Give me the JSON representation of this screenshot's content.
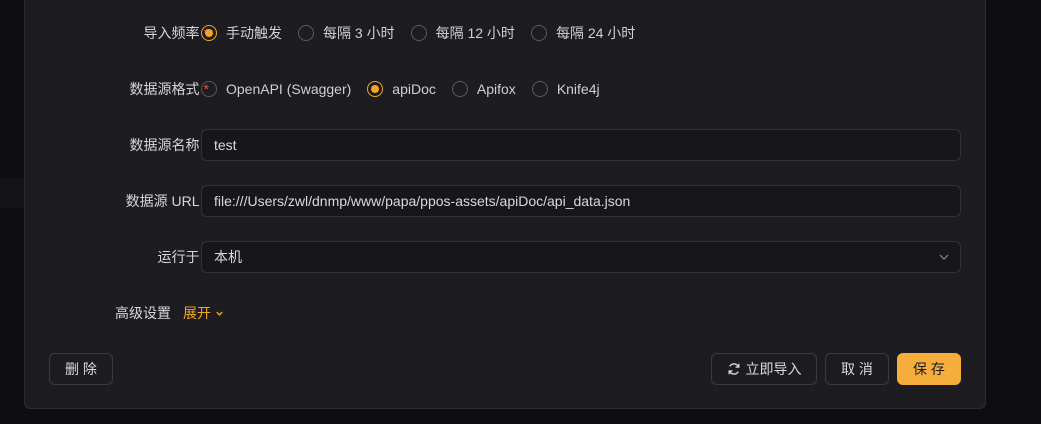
{
  "form": {
    "import_frequency": {
      "label": "导入频率",
      "required_mark": "*",
      "options": [
        {
          "label": "手动触发",
          "checked": true
        },
        {
          "label": "每隔 3 小时",
          "checked": false
        },
        {
          "label": "每隔 12 小时",
          "checked": false
        },
        {
          "label": "每隔 24 小时",
          "checked": false
        }
      ]
    },
    "source_format": {
      "label": "数据源格式",
      "required_mark": "*",
      "options": [
        {
          "label": "OpenAPI (Swagger)",
          "checked": false
        },
        {
          "label": "apiDoc",
          "checked": true
        },
        {
          "label": "Apifox",
          "checked": false
        },
        {
          "label": "Knife4j",
          "checked": false
        }
      ]
    },
    "source_name": {
      "label": "数据源名称",
      "required_mark": "*",
      "value": "test"
    },
    "source_url": {
      "label": "数据源 URL",
      "required_mark": "*",
      "value": "file:///Users/zwl/dnmp/www/papa/ppos-assets/apiDoc/api_data.json"
    },
    "run_on": {
      "label": "运行于",
      "required_mark": "*",
      "value": "本机"
    },
    "advanced": {
      "label": "高级设置",
      "toggle_label": "展开"
    }
  },
  "footer": {
    "delete_label": "删 除",
    "import_now_label": "立即导入",
    "cancel_label": "取 消",
    "save_label": "保 存"
  },
  "colors": {
    "accent": "#f5a524",
    "required": "#e0584c",
    "dialog_bg": "#1c1c21"
  }
}
